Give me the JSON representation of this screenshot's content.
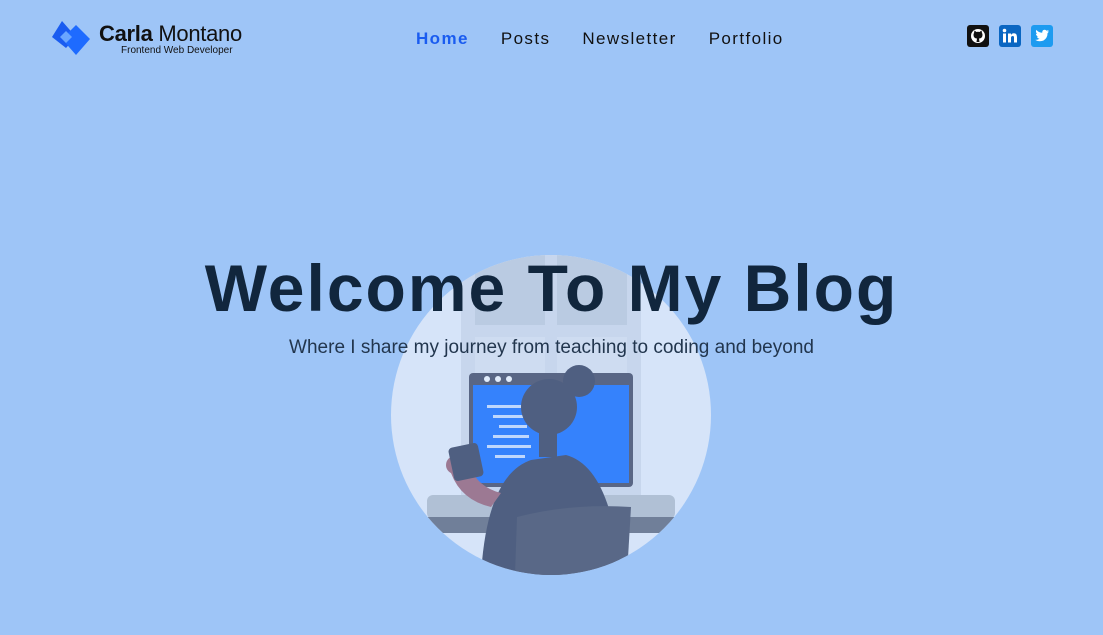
{
  "brand": {
    "first_name": "Carla",
    "last_name": "Montano",
    "tagline": "Frontend Web Developer",
    "logo_icon": "diamond-logo-icon",
    "color": "#1a5cf0"
  },
  "nav": {
    "items": [
      {
        "label": "Home",
        "active": true
      },
      {
        "label": "Posts",
        "active": false
      },
      {
        "label": "Newsletter",
        "active": false
      },
      {
        "label": "Portfolio",
        "active": false
      }
    ],
    "active_color": "#1a5cf0"
  },
  "socials": [
    {
      "icon": "github-icon"
    },
    {
      "icon": "linkedin-icon"
    },
    {
      "icon": "twitter-icon"
    }
  ],
  "hero": {
    "title": "Welcome To My Blog",
    "subtitle": "Where I share my journey from teaching to coding and beyond"
  },
  "colors": {
    "background": "#9ec5f7",
    "title": "#11263d"
  }
}
